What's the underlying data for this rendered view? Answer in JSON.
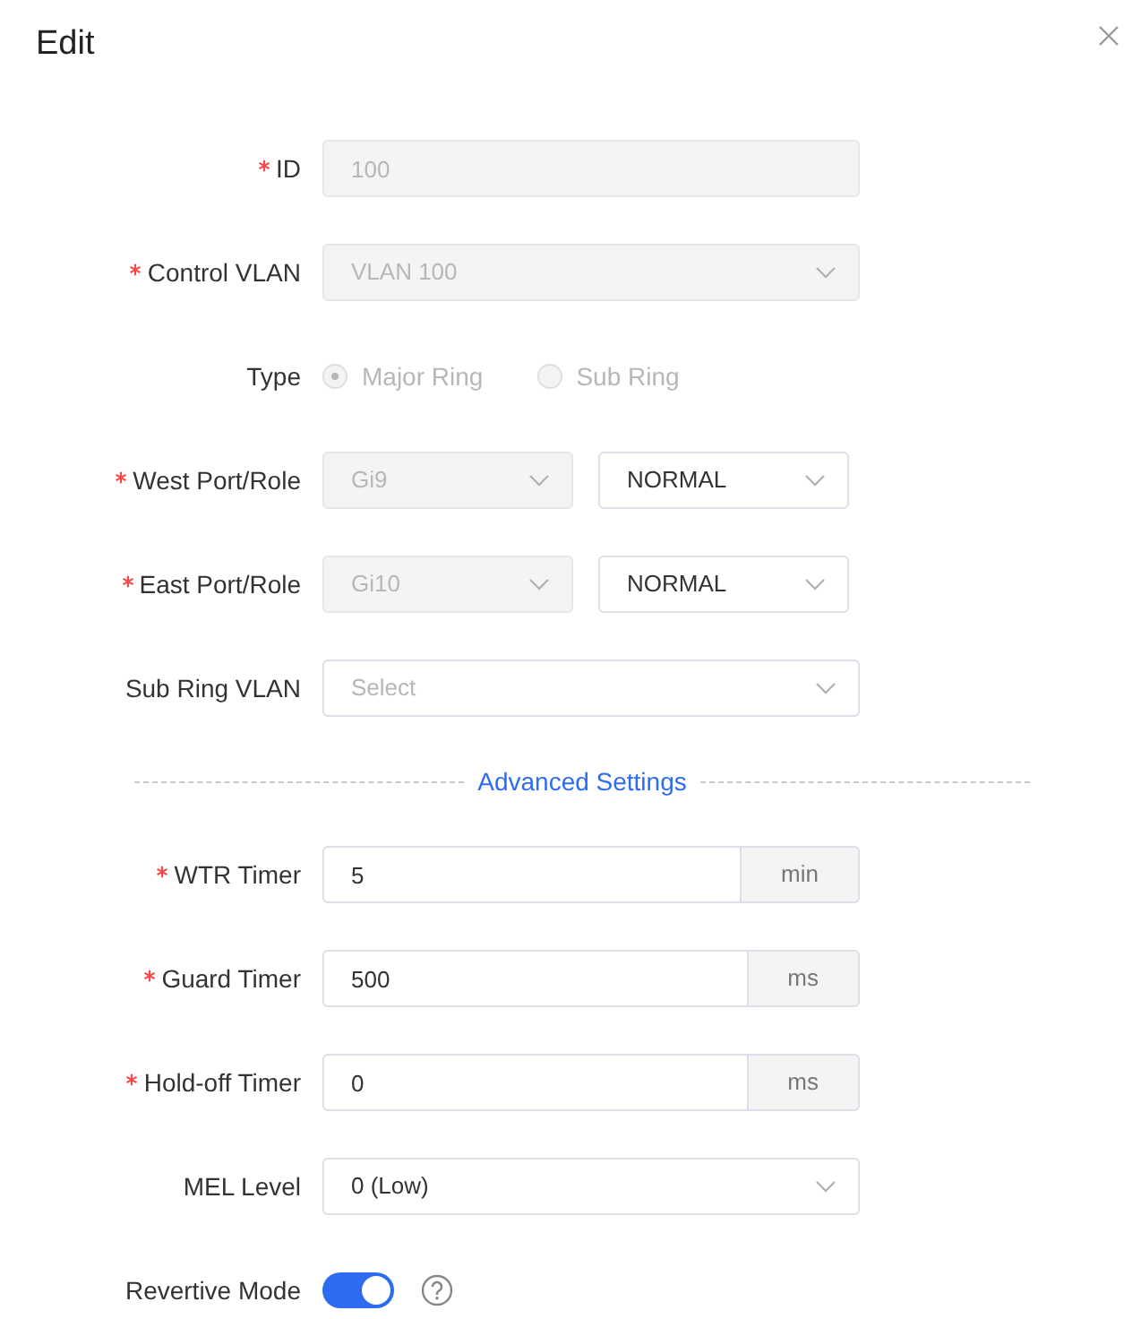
{
  "dialog": {
    "title": "Edit"
  },
  "fields": [
    {
      "kind": "input",
      "label": "ID",
      "required": true,
      "value": "100",
      "disabled": true
    },
    {
      "kind": "select",
      "label": "Control VLAN",
      "required": true,
      "value": "VLAN 100",
      "disabled": true
    },
    {
      "kind": "radio",
      "label": "Type",
      "options": [
        {
          "label": "Major Ring",
          "selected": true,
          "disabled": true
        },
        {
          "label": "Sub Ring",
          "selected": false,
          "disabled": true
        }
      ]
    },
    {
      "kind": "port-role",
      "label": "West Port/Role",
      "required": true,
      "port": {
        "value": "Gi9",
        "disabled": true
      },
      "role": {
        "value": "NORMAL"
      }
    },
    {
      "kind": "port-role",
      "label": "East Port/Role",
      "required": true,
      "port": {
        "value": "Gi10",
        "disabled": true
      },
      "role": {
        "value": "NORMAL"
      }
    },
    {
      "kind": "select",
      "label": "Sub Ring VLAN",
      "placeholder": "Select"
    },
    {
      "kind": "section",
      "label": "Advanced Settings"
    },
    {
      "kind": "unit-input",
      "label": "WTR Timer",
      "required": true,
      "value": "5",
      "unit": "min"
    },
    {
      "kind": "unit-input",
      "label": "Guard Timer",
      "required": true,
      "value": "500",
      "unit": "ms"
    },
    {
      "kind": "unit-input",
      "label": "Hold-off Timer",
      "required": true,
      "value": "0",
      "unit": "ms"
    },
    {
      "kind": "select",
      "label": "MEL Level",
      "value": "0 (Low)"
    },
    {
      "kind": "switch",
      "label": "Revertive Mode",
      "on": true,
      "help": true
    }
  ]
}
